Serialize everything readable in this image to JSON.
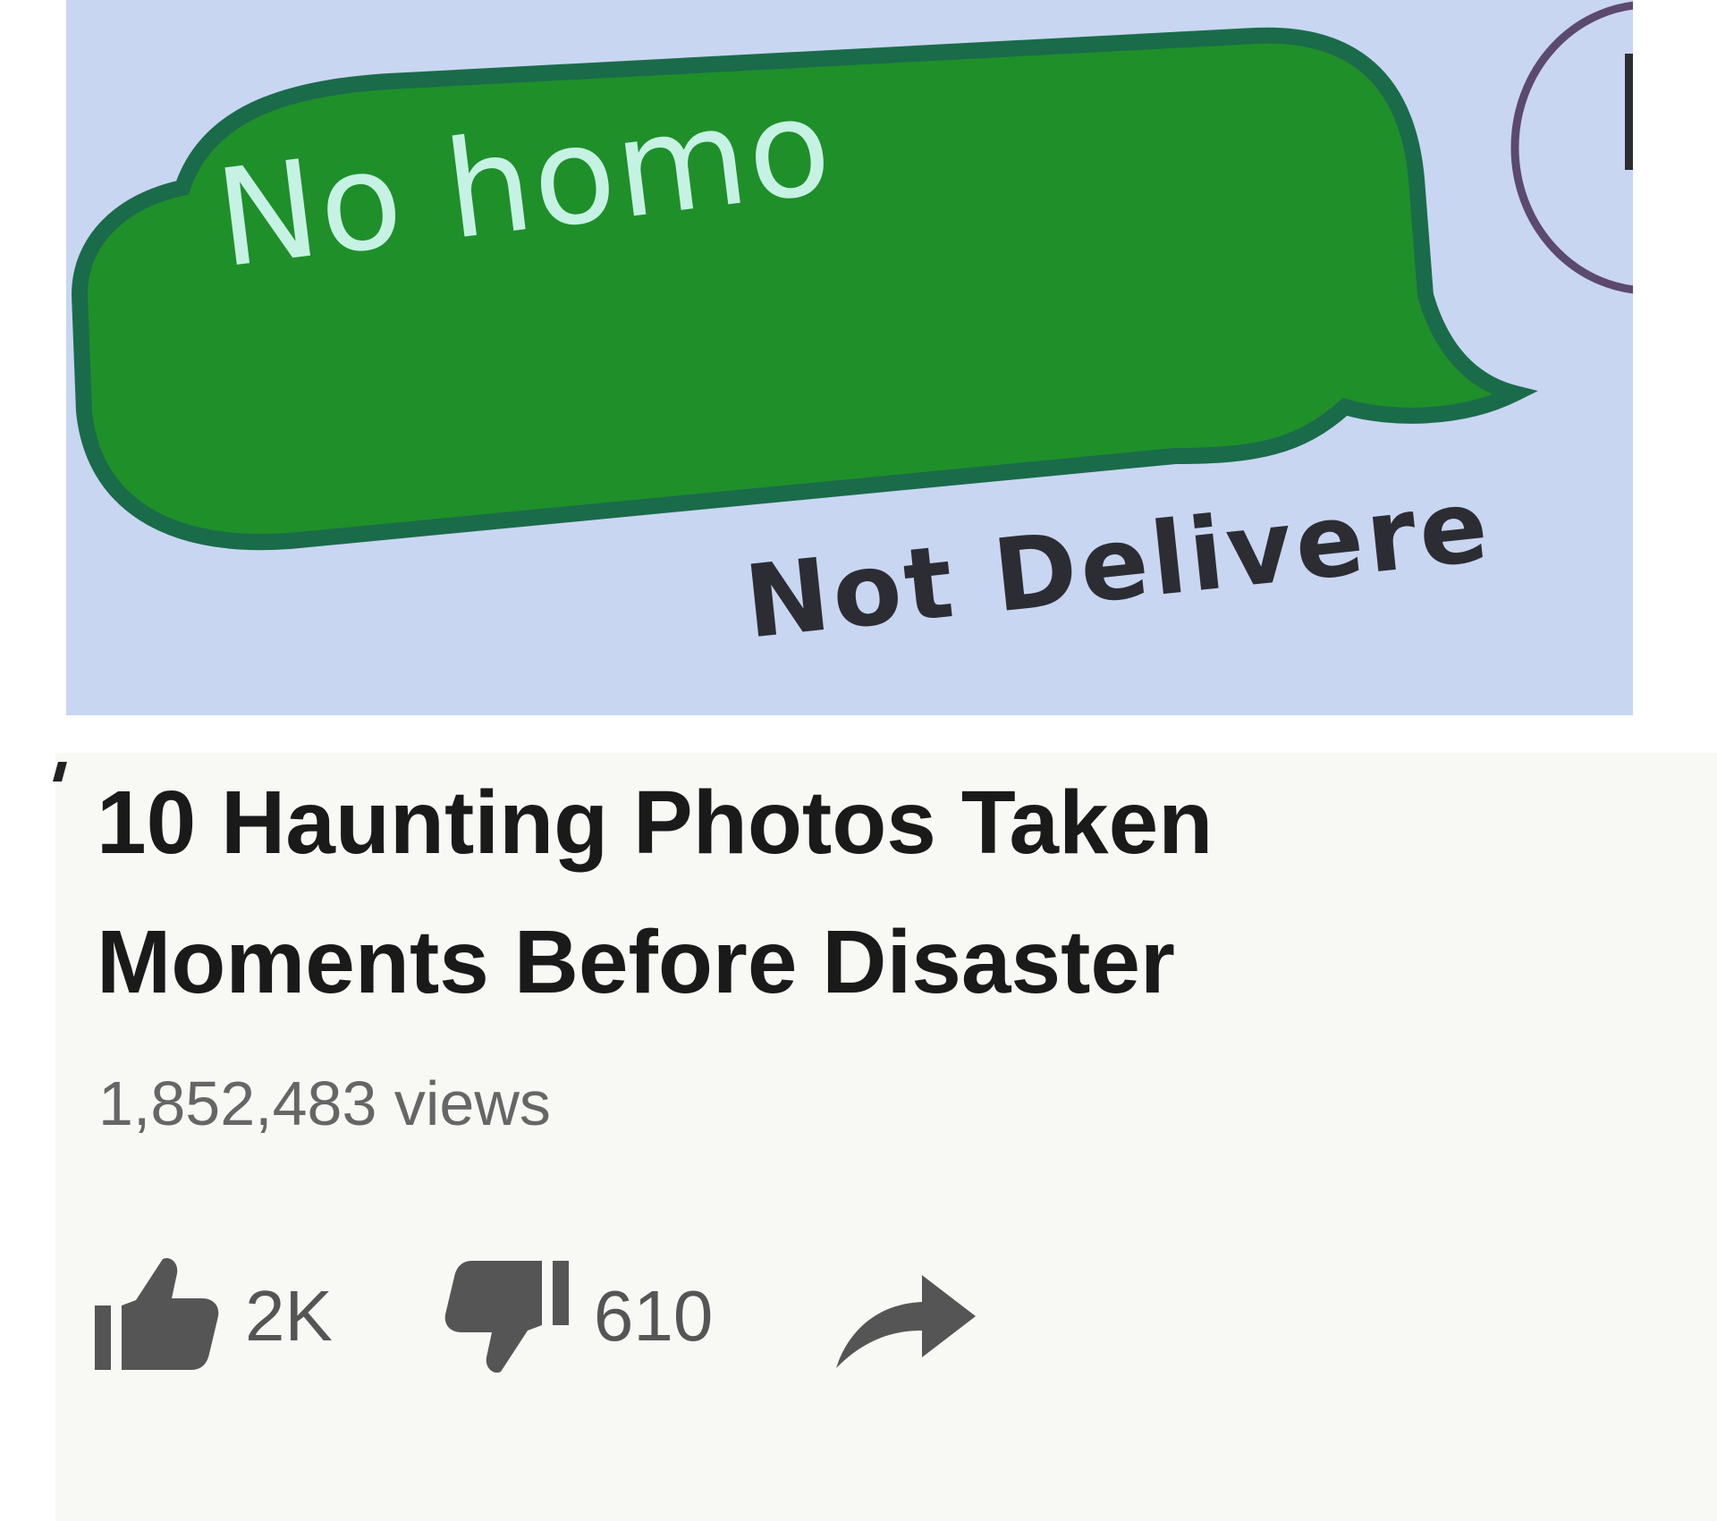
{
  "sms": {
    "message_text": "No homo",
    "status_text": "Not Delivere",
    "bubble_color": "#1f8f2a",
    "bubble_border_color": "#1a6b4a",
    "background_color": "#c9d6f2",
    "status_icon": "exclamation-circle-icon"
  },
  "video": {
    "title_line_1": "10 Haunting Photos Taken",
    "title_line_2": "Moments Before Disaster",
    "views": "1,852,483 views",
    "likes": "2K",
    "dislikes": "610",
    "like_icon": "thumbs-up-icon",
    "dislike_icon": "thumbs-down-icon",
    "share_icon": "share-arrow-icon"
  }
}
